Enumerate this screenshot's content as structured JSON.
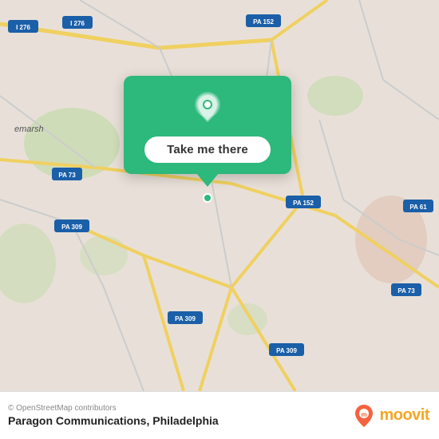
{
  "map": {
    "attribution": "© OpenStreetMap contributors",
    "background_color": "#e8e0d8"
  },
  "popup": {
    "button_label": "Take me there",
    "bg_color": "#2db87c"
  },
  "bottom_bar": {
    "copyright": "© OpenStreetMap contributors",
    "location": "Paragon Communications, Philadelphia",
    "moovit_label": "moovit"
  },
  "road_labels": [
    "I 276",
    "PA 152",
    "PA 73",
    "PA 309",
    "PA 152",
    "PA 309",
    "PA 309",
    "PA 61",
    "PA 73",
    "I 276"
  ]
}
